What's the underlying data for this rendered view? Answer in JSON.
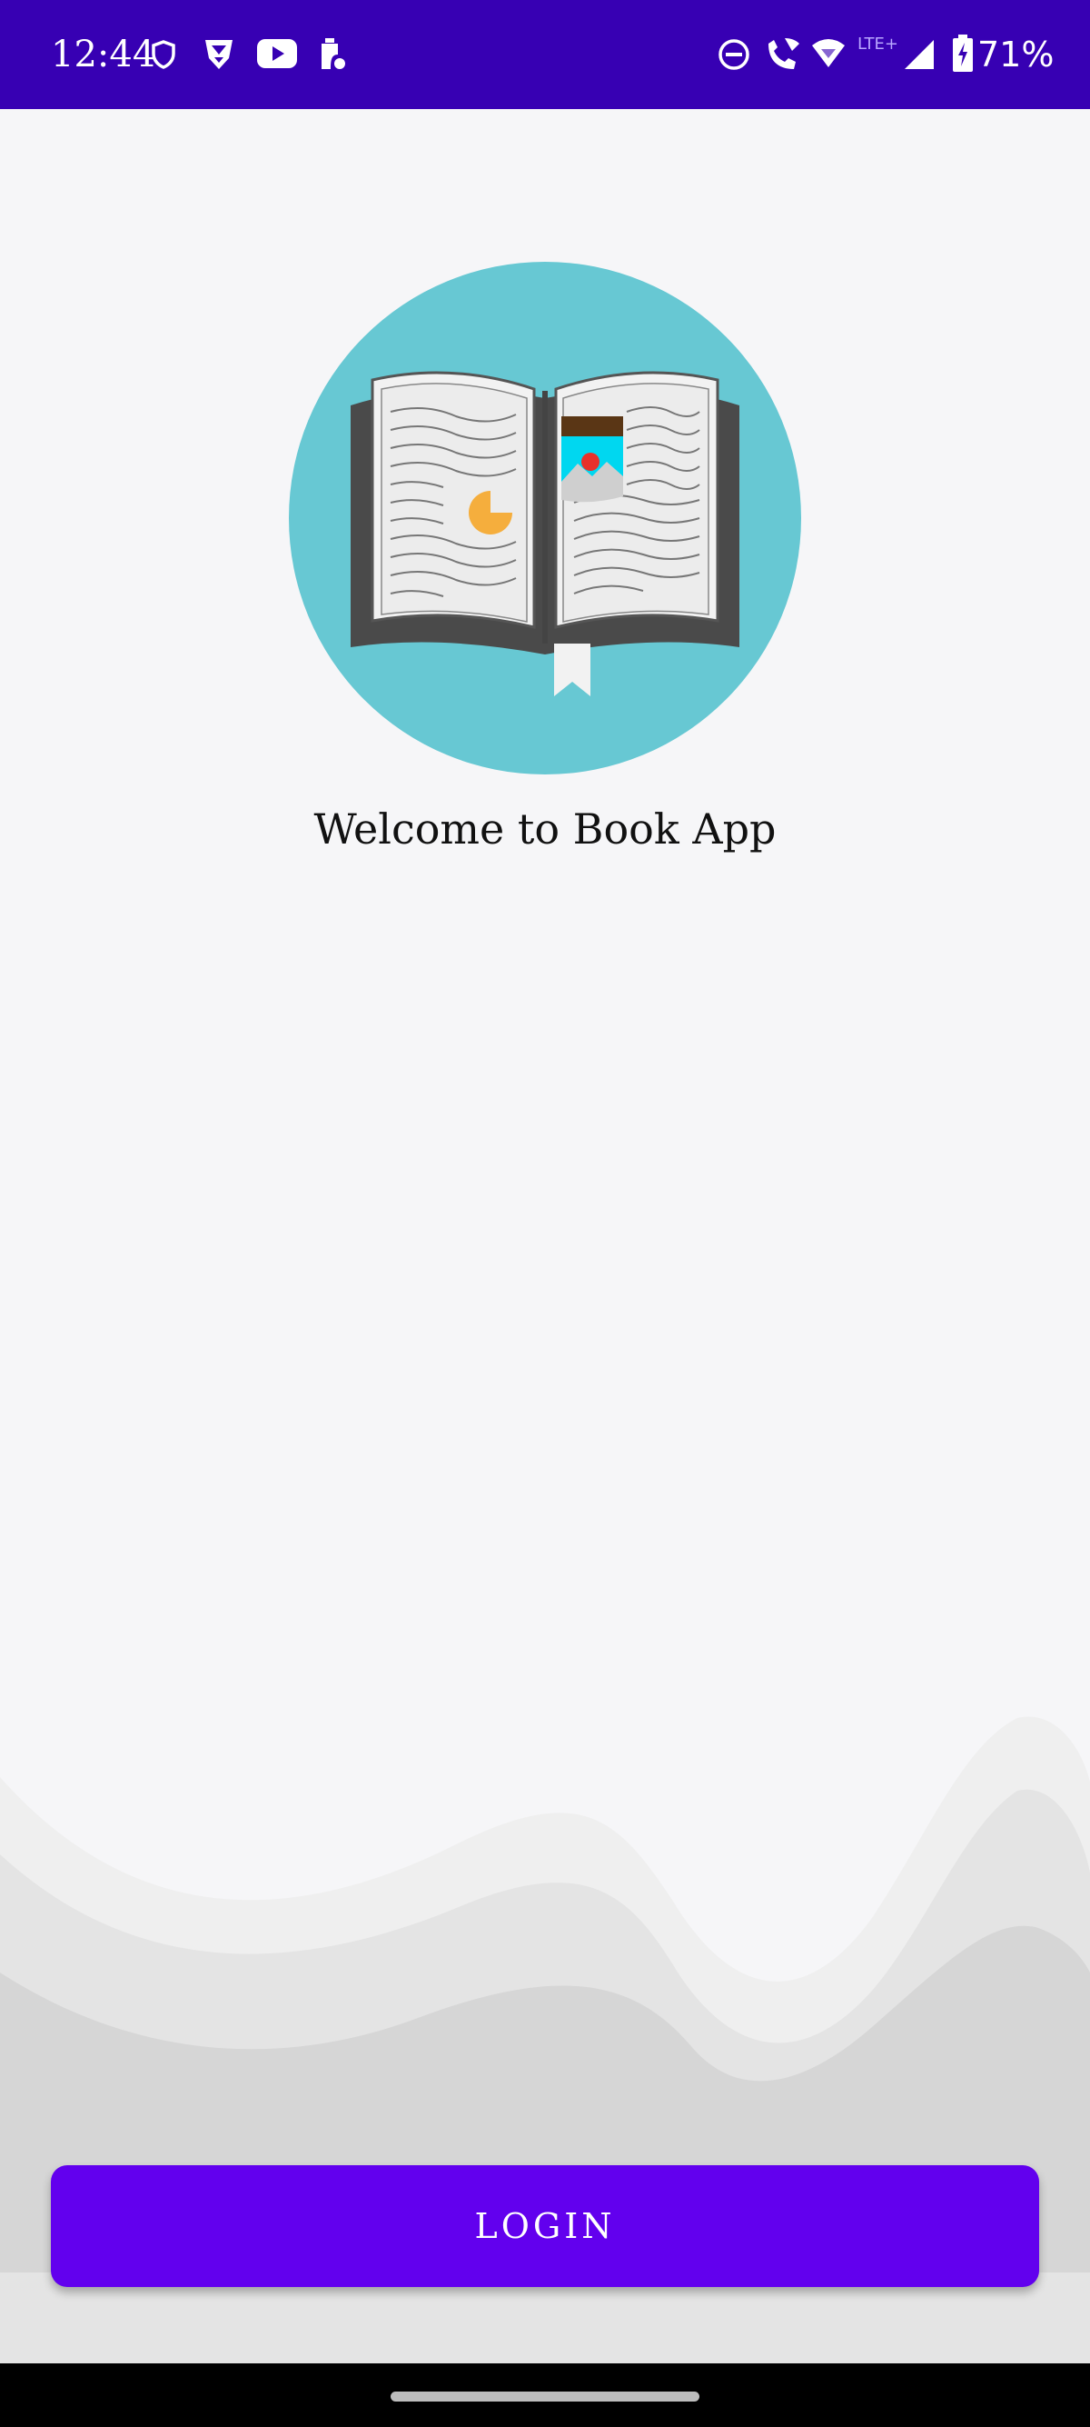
{
  "status_bar": {
    "time": "12:44",
    "battery": "71%",
    "icons": [
      "shield-icon",
      "vpn-icon",
      "youtube-icon",
      "battery-saver-icon",
      "do-not-disturb-icon",
      "wifi-calling-icon",
      "wifi-icon",
      "lte-icon",
      "signal-icon",
      "battery-charging-icon"
    ],
    "lte_label": "LTE+",
    "background": "#3700b3"
  },
  "main": {
    "logo_icon": "open-book-icon",
    "welcome_text": "Welcome to Book App",
    "logo_circle_color": "#67c8d3"
  },
  "actions": {
    "login_label": "LOGIN",
    "login_color": "#6200ee"
  }
}
